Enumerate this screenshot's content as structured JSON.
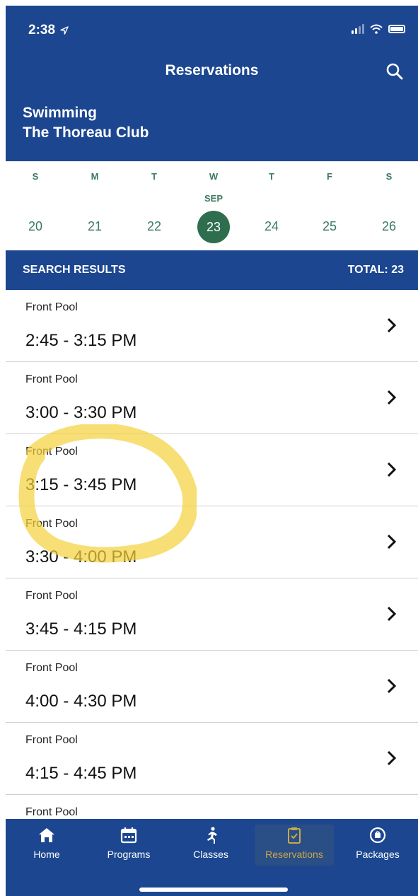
{
  "status_bar": {
    "time": "2:38"
  },
  "header": {
    "title": "Reservations",
    "activity": "Swimming",
    "club": "The Thoreau Club"
  },
  "calendar": {
    "month": "SEP",
    "days": [
      {
        "dow": "S",
        "date": "20"
      },
      {
        "dow": "M",
        "date": "21"
      },
      {
        "dow": "T",
        "date": "22"
      },
      {
        "dow": "W",
        "date": "23",
        "selected": true
      },
      {
        "dow": "T",
        "date": "24"
      },
      {
        "dow": "F",
        "date": "25"
      },
      {
        "dow": "S",
        "date": "26"
      }
    ]
  },
  "results": {
    "label": "SEARCH RESULTS",
    "total": "TOTAL: 23"
  },
  "slots": [
    {
      "location": "Front Pool",
      "time": "2:45 - 3:15 PM"
    },
    {
      "location": "Front Pool",
      "time": "3:00 - 3:30 PM"
    },
    {
      "location": "Front Pool",
      "time": "3:15 - 3:45 PM"
    },
    {
      "location": "Front Pool",
      "time": "3:30 - 4:00 PM"
    },
    {
      "location": "Front Pool",
      "time": "3:45 - 4:15 PM"
    },
    {
      "location": "Front Pool",
      "time": "4:00 - 4:30 PM"
    },
    {
      "location": "Front Pool",
      "time": "4:15 - 4:45 PM"
    },
    {
      "location": "Front Pool",
      "time": ""
    }
  ],
  "tabs": [
    {
      "label": "Home",
      "icon": "home-icon"
    },
    {
      "label": "Programs",
      "icon": "calendar-icon"
    },
    {
      "label": "Classes",
      "icon": "runner-icon"
    },
    {
      "label": "Reservations",
      "icon": "clipboard-check-icon",
      "active": true
    },
    {
      "label": "Packages",
      "icon": "package-icon"
    }
  ],
  "colors": {
    "brand_blue": "#1c4690",
    "calendar_green": "#2e6e4f",
    "active_tab_text": "#c8a94a",
    "highlight_yellow": "#f4d23c"
  }
}
